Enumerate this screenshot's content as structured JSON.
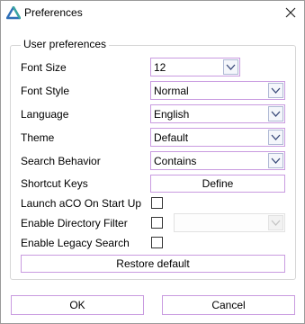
{
  "window": {
    "title": "Preferences",
    "app_icon": "triangle-logo-icon",
    "close_icon": "close-icon"
  },
  "group": {
    "legend": "User preferences"
  },
  "rows": {
    "font_size": {
      "label": "Font Size",
      "value": "12"
    },
    "font_style": {
      "label": "Font Style",
      "value": "Normal"
    },
    "language": {
      "label": "Language",
      "value": "English"
    },
    "theme": {
      "label": "Theme",
      "value": "Default"
    },
    "search_behavior": {
      "label": "Search Behavior",
      "value": "Contains"
    },
    "shortcut_keys": {
      "label": "Shortcut Keys",
      "button": "Define"
    },
    "launch_on_start": {
      "label": "Launch aCO On Start Up",
      "checked": false
    },
    "directory_filter": {
      "label": "Enable Directory Filter",
      "checked": false,
      "combo_value": ""
    },
    "legacy_search": {
      "label": "Enable Legacy Search",
      "checked": false
    }
  },
  "restore_label": "Restore default",
  "footer": {
    "ok_label": "OK",
    "cancel_label": "Cancel"
  },
  "colors": {
    "accent_border": "#c99be0",
    "arrow_border": "#aeb8d4",
    "logo_blue": "#2f6fb7",
    "logo_teal": "#3aa6a0"
  }
}
